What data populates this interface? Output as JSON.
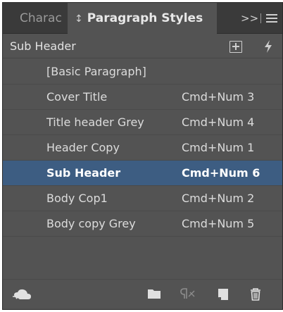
{
  "tabs": {
    "inactive_label": "Charac",
    "active_label": "Paragraph Styles",
    "updown_glyph": "↕"
  },
  "overflow_glyph": ">>",
  "header": {
    "current_style": "Sub Header"
  },
  "styles": [
    {
      "name": "[Basic Paragraph]",
      "shortcut": ""
    },
    {
      "name": "Cover Title",
      "shortcut": "Cmd+Num 3"
    },
    {
      "name": "Title header Grey",
      "shortcut": "Cmd+Num 4"
    },
    {
      "name": "Header Copy",
      "shortcut": "Cmd+Num 1"
    },
    {
      "name": "Sub Header",
      "shortcut": "Cmd+Num 6",
      "selected": true
    },
    {
      "name": "Body Cop1",
      "shortcut": "Cmd+Num 2"
    },
    {
      "name": "Body copy Grey",
      "shortcut": "Cmd+Num 5"
    }
  ],
  "footer_icons": [
    "cc-libraries-icon",
    "folder-icon",
    "clear-overrides-icon",
    "new-style-icon",
    "trash-icon"
  ],
  "colors": {
    "panel_bg": "#535353",
    "tabbar_bg": "#3a3a3a",
    "selection": "#3d5d82"
  }
}
